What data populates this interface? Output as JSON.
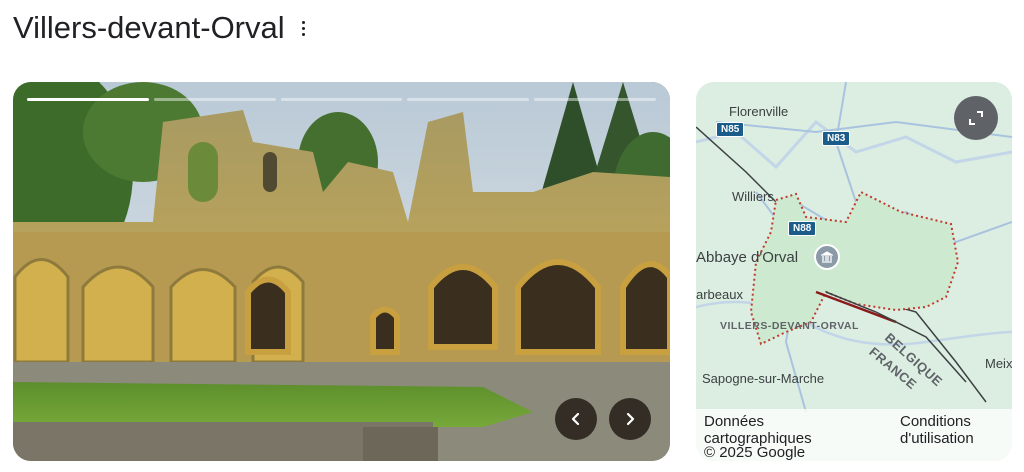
{
  "page": {
    "title": "Villers-devant-Orval",
    "more_icon": "more-vert-icon"
  },
  "gallery": {
    "slides_total": 5,
    "active_slide": 1,
    "prev_icon": "chevron-left-icon",
    "next_icon": "chevron-right-icon"
  },
  "map": {
    "expand_icon": "expand-icon",
    "labels": {
      "florenville": "Florenville",
      "williers": "Williers",
      "abbaye": "Abbaye d'Orval",
      "arbeaux": "arbeaux",
      "villers": "VILLERS-DEVANT-ORVAL",
      "belgique": "BELGIQUE",
      "france": "FRANCE",
      "sapogne": "Sapogne-sur-Marche",
      "meix": "Meix"
    },
    "roads": {
      "n85": "N85",
      "n83": "N83",
      "n88": "N88"
    },
    "footer": {
      "map_data": "Données cartographiques",
      "terms": "Conditions d'utilisation",
      "copyright": "© 2025 Google"
    },
    "colors": {
      "land": "#dceee2",
      "road": "#a9c3df",
      "boundary": "#c0392b",
      "shield": "#1a5c8a"
    }
  }
}
